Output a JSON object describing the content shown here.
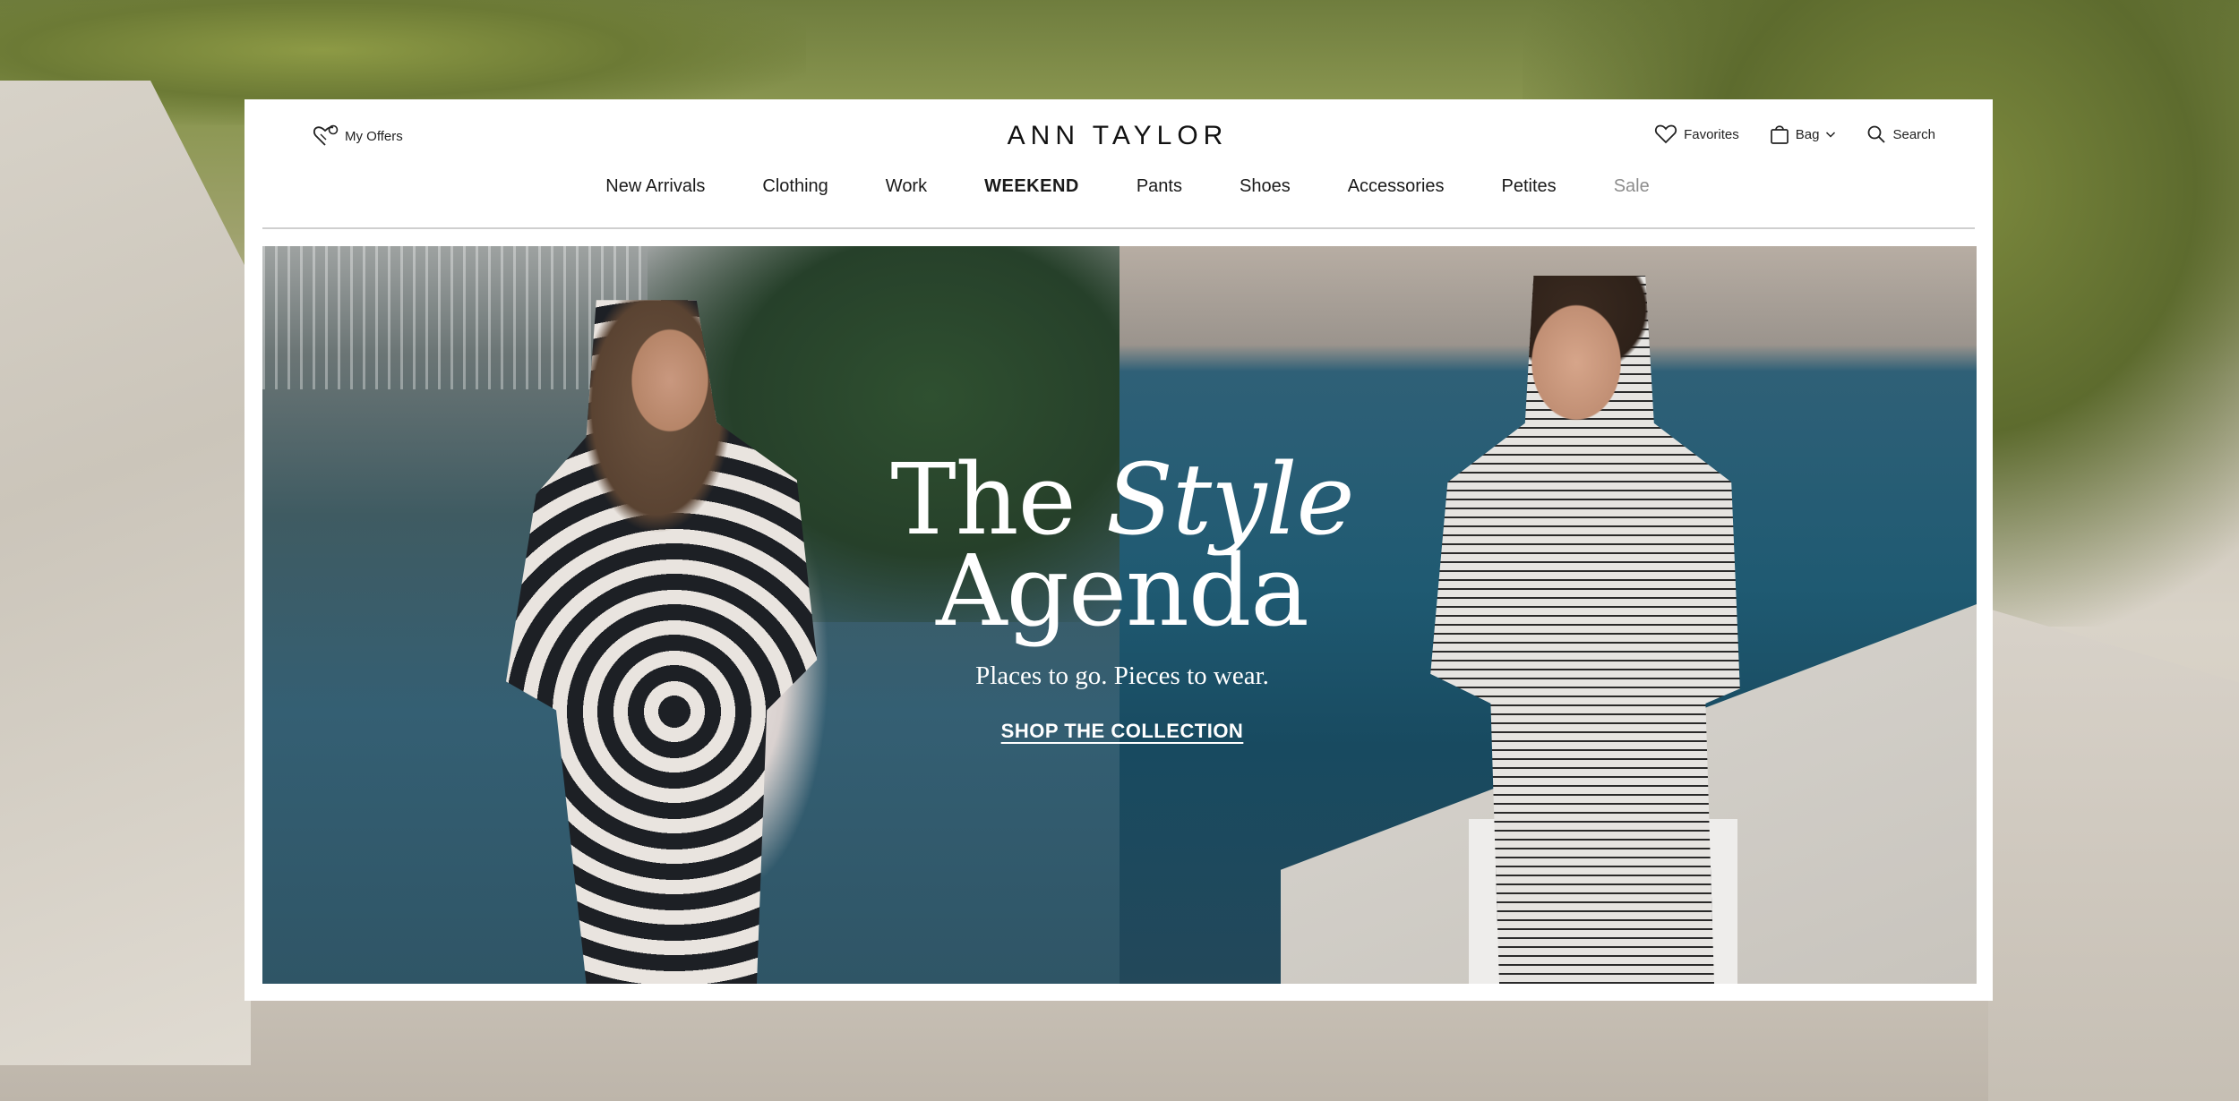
{
  "header": {
    "offers_label": "My Offers",
    "logo_text": "ANN TAYLOR",
    "favorites_label": "Favorites",
    "bag_label": "Bag",
    "search_label": "Search"
  },
  "nav": {
    "items": [
      {
        "label": "New Arrivals"
      },
      {
        "label": "Clothing"
      },
      {
        "label": "Work"
      },
      {
        "label": "WEEKEND"
      },
      {
        "label": "Pants"
      },
      {
        "label": "Shoes"
      },
      {
        "label": "Accessories"
      },
      {
        "label": "Petites"
      },
      {
        "label": "Sale"
      }
    ]
  },
  "hero": {
    "headline_word1": "The",
    "headline_word2": "Style",
    "headline_line2": "Agenda",
    "subhead": "Places to go. Pieces to wear.",
    "cta_label": "SHOP THE COLLECTION"
  },
  "icons": {
    "offers": "heart-tag-icon",
    "favorites": "heart-icon",
    "bag": "shopping-bag-icon",
    "bag_toggle": "chevron-down-icon",
    "search": "search-icon"
  },
  "colors": {
    "text_primary": "#1a1a1a",
    "sale_muted": "#8c8c8c",
    "hero_text": "#ffffff",
    "card_bg": "#ffffff"
  }
}
